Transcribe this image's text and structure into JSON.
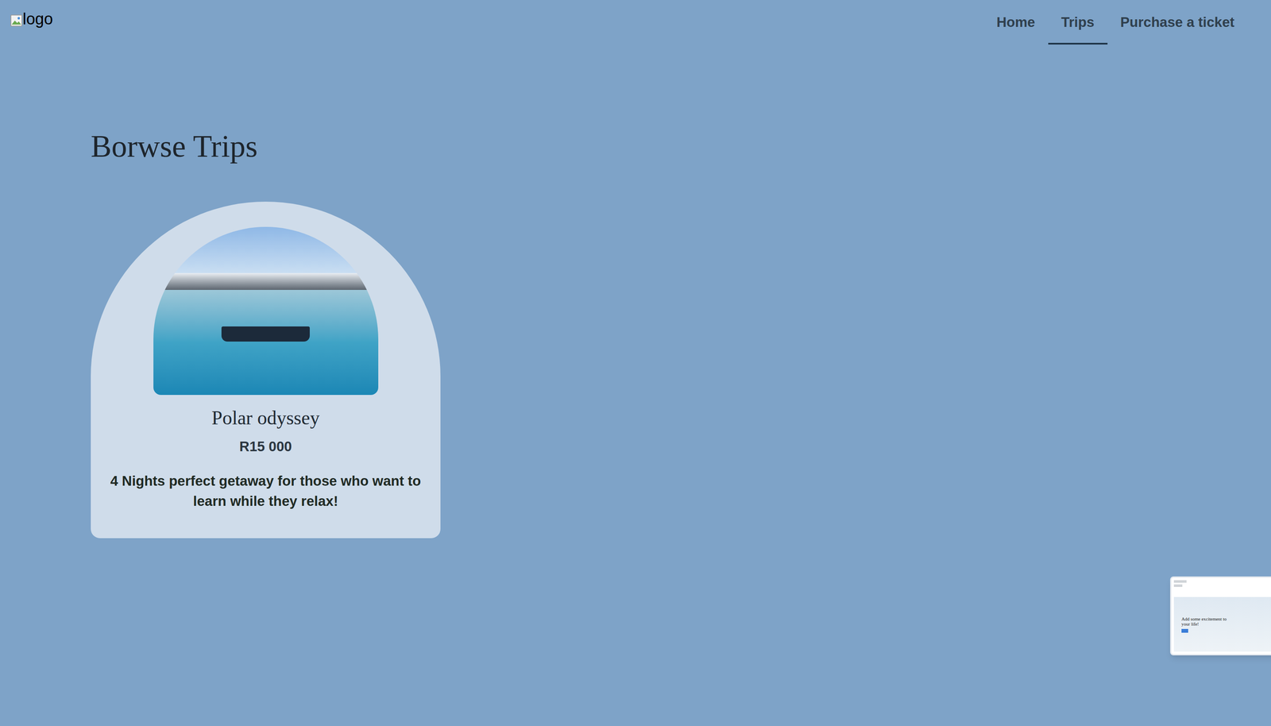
{
  "header": {
    "logo_alt": "logo",
    "nav": [
      {
        "label": "Home",
        "selected": false
      },
      {
        "label": "Trips",
        "selected": true
      },
      {
        "label": "Purchase a ticket",
        "selected": false
      }
    ]
  },
  "page": {
    "title": "Borwse Trips"
  },
  "trips": [
    {
      "name": "Polar odyssey",
      "price": "R15 000",
      "description": "4 Nights perfect getaway for those who want to learn while they relax!"
    }
  ],
  "preview": {
    "headline": "Add some excitement to your life!"
  }
}
